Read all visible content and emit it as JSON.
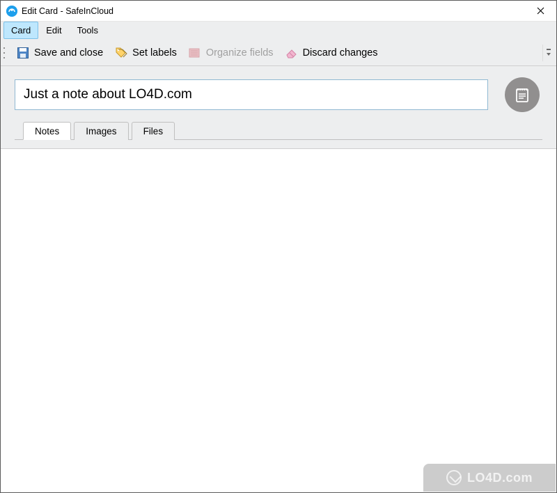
{
  "window": {
    "title": "Edit Card - SafeInCloud"
  },
  "menu": {
    "items": [
      {
        "label": "Card",
        "active": true
      },
      {
        "label": "Edit",
        "active": false
      },
      {
        "label": "Tools",
        "active": false
      }
    ]
  },
  "toolbar": {
    "save": "Save and close",
    "labels": "Set labels",
    "organize": "Organize fields",
    "discard": "Discard changes"
  },
  "card": {
    "title_value": "Just a note about LO4D.com"
  },
  "tabs": {
    "items": [
      {
        "label": "Notes",
        "active": true
      },
      {
        "label": "Images",
        "active": false
      },
      {
        "label": "Files",
        "active": false
      }
    ]
  },
  "watermark": {
    "text": "LO4D.com"
  }
}
